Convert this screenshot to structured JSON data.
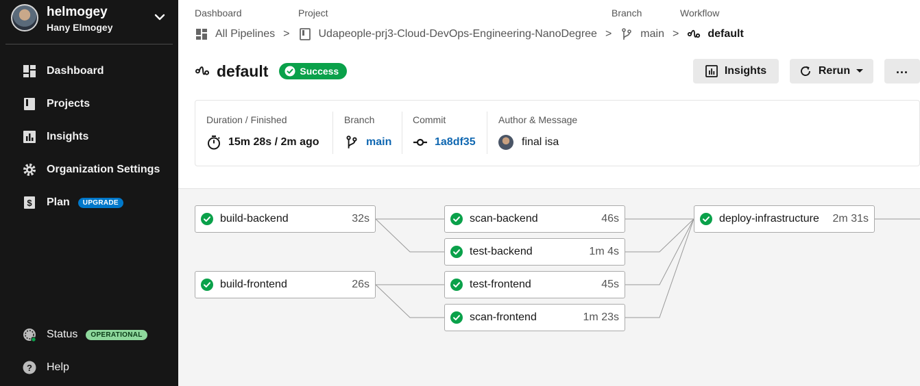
{
  "org": {
    "name": "helmogey",
    "user": "Hany Elmogey"
  },
  "nav": {
    "dashboard": "Dashboard",
    "projects": "Projects",
    "insights": "Insights",
    "org_settings": "Organization Settings",
    "plan": "Plan",
    "plan_badge": "UPGRADE",
    "status": "Status",
    "status_badge": "OPERATIONAL",
    "help": "Help"
  },
  "breadcrumb": {
    "headers": {
      "dashboard": "Dashboard",
      "project": "Project",
      "branch": "Branch",
      "workflow": "Workflow"
    },
    "dashboard": "All Pipelines",
    "project": "Udapeople-prj3-Cloud-DevOps-Engineering-NanoDegree",
    "branch": "main",
    "workflow": "default",
    "separator": ">"
  },
  "header": {
    "title": "default",
    "status": "Success"
  },
  "actions": {
    "insights": "Insights",
    "rerun": "Rerun",
    "more": "..."
  },
  "meta": {
    "duration_label": "Duration / Finished",
    "duration_value": "15m 28s / 2m ago",
    "branch_label": "Branch",
    "branch_value": "main",
    "commit_label": "Commit",
    "commit_value": "1a8df35",
    "author_label": "Author & Message",
    "author_message": "final isa"
  },
  "jobs": [
    {
      "name": "build-backend",
      "duration": "32s",
      "status": "success"
    },
    {
      "name": "build-frontend",
      "duration": "26s",
      "status": "success"
    },
    {
      "name": "scan-backend",
      "duration": "46s",
      "status": "success"
    },
    {
      "name": "test-backend",
      "duration": "1m 4s",
      "status": "success"
    },
    {
      "name": "test-frontend",
      "duration": "45s",
      "status": "success"
    },
    {
      "name": "scan-frontend",
      "duration": "1m 23s",
      "status": "success"
    },
    {
      "name": "deploy-infrastructure",
      "duration": "2m 31s",
      "status": "success"
    }
  ],
  "colors": {
    "sidebar_bg": "#161616",
    "success": "#0aa14a",
    "link": "#0f67b1",
    "upgrade_badge": "#0078ca",
    "operational_badge": "#8ed89c"
  }
}
